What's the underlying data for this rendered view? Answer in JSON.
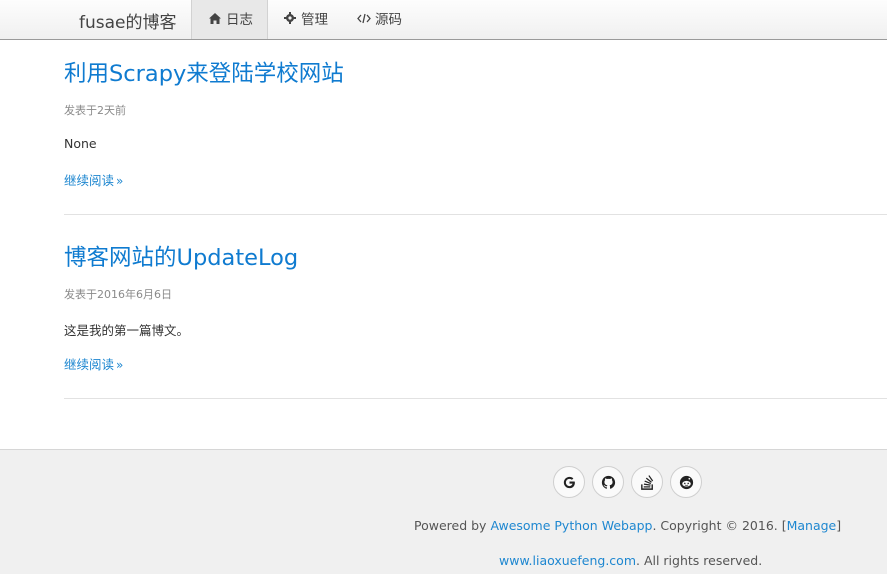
{
  "navbar": {
    "brand": "fusae的博客",
    "items": [
      {
        "icon": "home-icon",
        "label": "日志"
      },
      {
        "icon": "gear-icon",
        "label": "管理"
      },
      {
        "icon": "code-icon",
        "label": "源码"
      }
    ]
  },
  "posts": [
    {
      "title": "利用Scrapy来登陆学校网站",
      "meta": "发表于2天前",
      "summary": "None",
      "read_more": "继续阅读"
    },
    {
      "title": "博客网站的UpdateLog",
      "meta": "发表于2016年6月6日",
      "summary": "这是我的第一篇博文。",
      "read_more": "继续阅读"
    }
  ],
  "footer": {
    "social_icons": [
      "google-icon",
      "github-icon",
      "stack-overflow-icon",
      "reddit-icon"
    ],
    "powered_by": "Powered by",
    "powered_link": "Awesome Python Webapp",
    "copyright": ". Copyright © 2016. [",
    "manage_link": "Manage",
    "manage_close": "]",
    "site_link": "www.liaoxuefeng.com",
    "rights": ". All rights reserved."
  }
}
